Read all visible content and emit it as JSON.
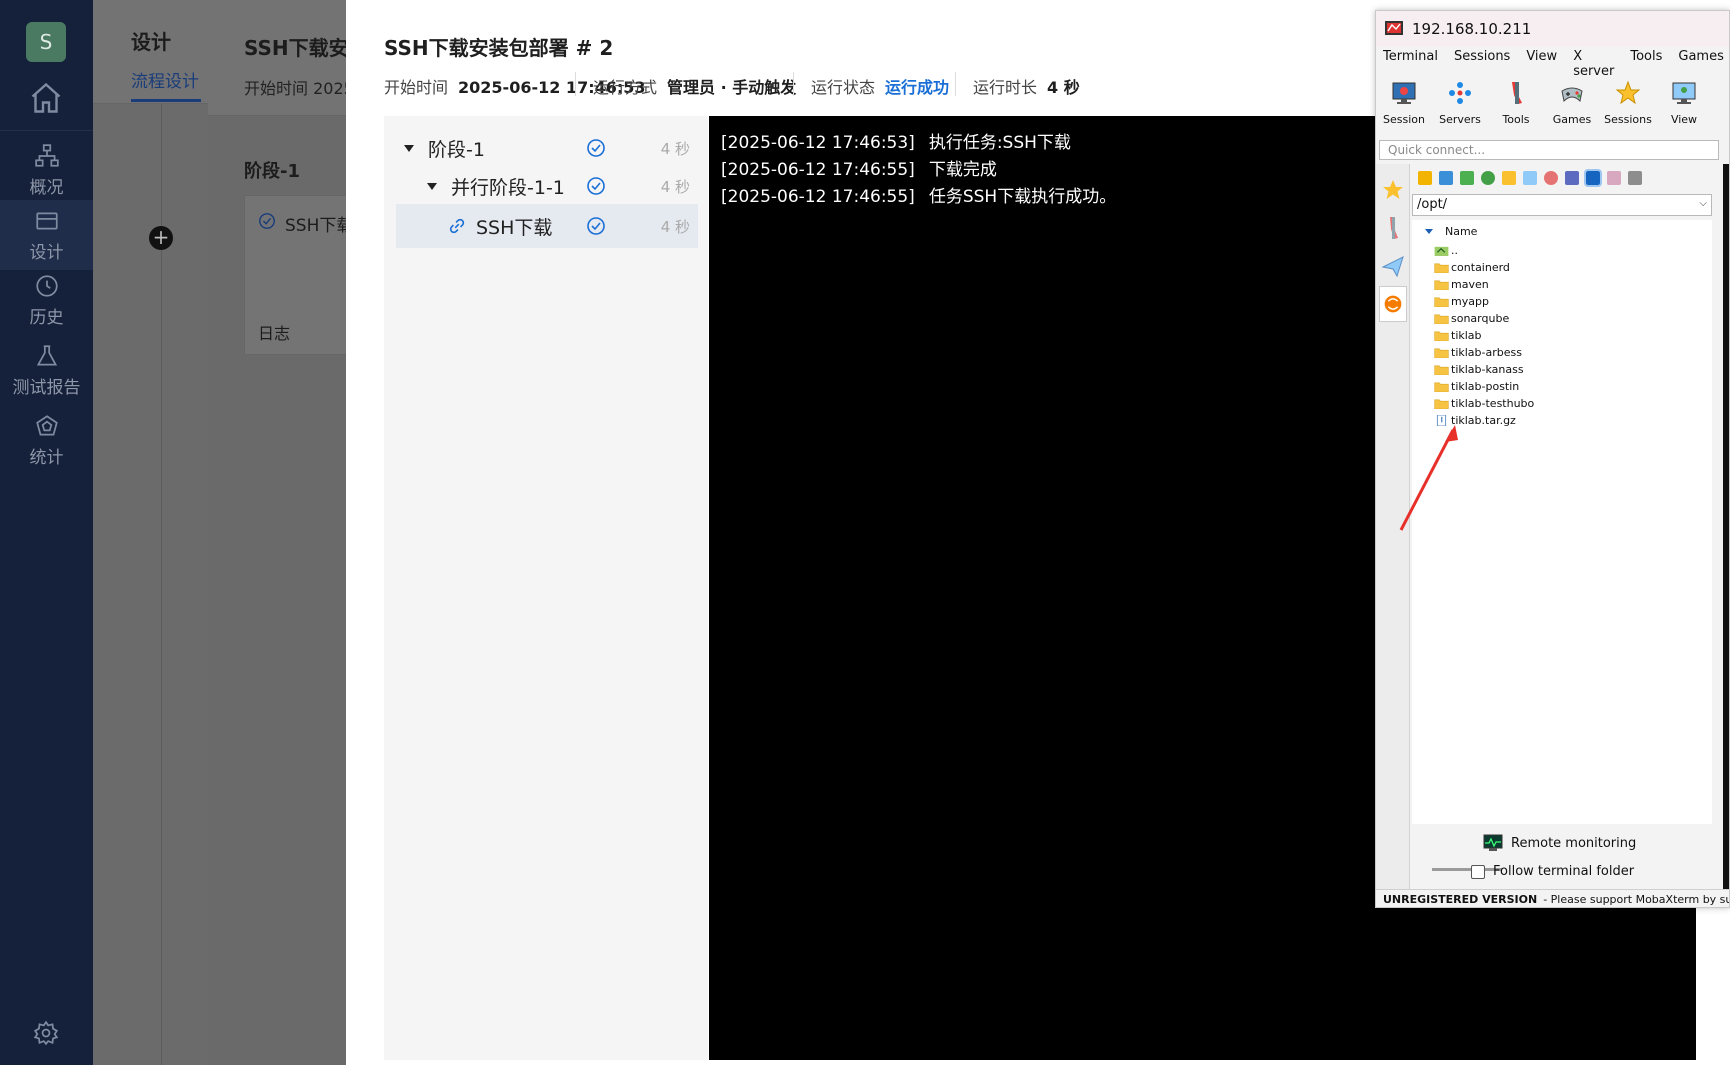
{
  "nav": {
    "avatar": "S",
    "items": [
      {
        "label": "概况"
      },
      {
        "label": "设计"
      },
      {
        "label": "历史"
      },
      {
        "label": "测试报告"
      },
      {
        "label": "统计"
      }
    ]
  },
  "design_panel": {
    "title": "设计",
    "tab": "流程设计"
  },
  "pipeline_panel": {
    "title": "SSH下载安装包部署",
    "meta": "开始时间  2025",
    "stage": "阶段-1",
    "card_label": "SSH下载",
    "log_label": "日志"
  },
  "drawer": {
    "title": "SSH下载安装包部署 # 2",
    "meta": {
      "start_label": "开始时间",
      "start_value": "2025-06-12 17:46:53",
      "mode_label": "运行方式",
      "mode_value": "管理员 · 手动触发",
      "status_label": "运行状态",
      "status_value": "运行成功",
      "duration_label": "运行时长",
      "duration_value": "4 秒"
    },
    "tree": [
      {
        "label": "阶段-1",
        "duration": "4 秒"
      },
      {
        "label": "并行阶段-1-1",
        "duration": "4 秒"
      },
      {
        "label": "SSH下载",
        "duration": "4 秒"
      }
    ],
    "log": [
      {
        "ts": "[2025-06-12 17:46:53]",
        "msg": "执行任务:SSH下载"
      },
      {
        "ts": "[2025-06-12 17:46:55]",
        "msg": "下载完成"
      },
      {
        "ts": "[2025-06-12 17:46:55]",
        "msg": "任务SSH下载执行成功。"
      }
    ]
  },
  "moba": {
    "title": "192.168.10.211",
    "menu": [
      "Terminal",
      "Sessions",
      "View",
      "X server",
      "Tools",
      "Games"
    ],
    "toolbar": [
      "Session",
      "Servers",
      "Tools",
      "Games",
      "Sessions",
      "View"
    ],
    "quick_connect_placeholder": "Quick connect...",
    "path": "/opt/",
    "column": "Name",
    "files": [
      "..",
      "containerd",
      "maven",
      "myapp",
      "sonarqube",
      "tiklab",
      "tiklab-arbess",
      "tiklab-kanass",
      "tiklab-postin",
      "tiklab-testhubo",
      "tiklab.tar.gz"
    ],
    "remote_monitoring": "Remote monitoring",
    "follow_terminal": "Follow terminal folder",
    "status_bold": "UNREGISTERED VERSION",
    "status_text": "-  Please support MobaXterm by su"
  },
  "colors": {
    "accent": "#1a6fd6",
    "nav_bg": "#15203a",
    "console_bg": "#000000",
    "annotation_arrow": "#e8302a"
  }
}
